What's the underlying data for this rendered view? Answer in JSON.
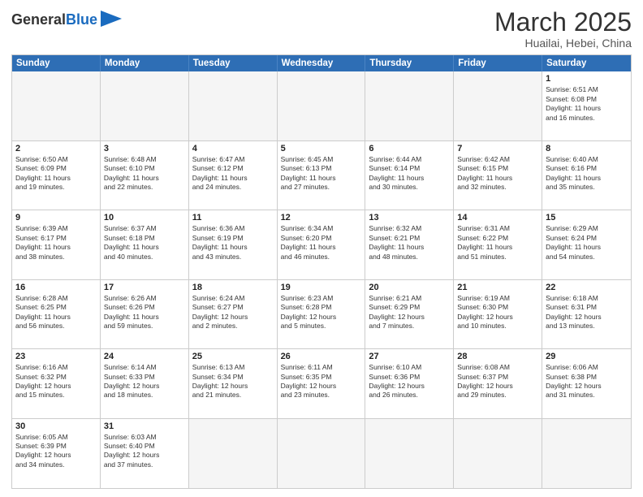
{
  "header": {
    "logo_general": "General",
    "logo_blue": "Blue",
    "month_year": "March 2025",
    "location": "Huailai, Hebei, China"
  },
  "weekdays": [
    "Sunday",
    "Monday",
    "Tuesday",
    "Wednesday",
    "Thursday",
    "Friday",
    "Saturday"
  ],
  "cells": [
    {
      "day": "",
      "info": "",
      "empty": true
    },
    {
      "day": "",
      "info": "",
      "empty": true
    },
    {
      "day": "",
      "info": "",
      "empty": true
    },
    {
      "day": "",
      "info": "",
      "empty": true
    },
    {
      "day": "",
      "info": "",
      "empty": true
    },
    {
      "day": "",
      "info": "",
      "empty": true
    },
    {
      "day": "1",
      "info": "Sunrise: 6:51 AM\nSunset: 6:08 PM\nDaylight: 11 hours\nand 16 minutes.",
      "empty": false
    },
    {
      "day": "2",
      "info": "Sunrise: 6:50 AM\nSunset: 6:09 PM\nDaylight: 11 hours\nand 19 minutes.",
      "empty": false
    },
    {
      "day": "3",
      "info": "Sunrise: 6:48 AM\nSunset: 6:10 PM\nDaylight: 11 hours\nand 22 minutes.",
      "empty": false
    },
    {
      "day": "4",
      "info": "Sunrise: 6:47 AM\nSunset: 6:12 PM\nDaylight: 11 hours\nand 24 minutes.",
      "empty": false
    },
    {
      "day": "5",
      "info": "Sunrise: 6:45 AM\nSunset: 6:13 PM\nDaylight: 11 hours\nand 27 minutes.",
      "empty": false
    },
    {
      "day": "6",
      "info": "Sunrise: 6:44 AM\nSunset: 6:14 PM\nDaylight: 11 hours\nand 30 minutes.",
      "empty": false
    },
    {
      "day": "7",
      "info": "Sunrise: 6:42 AM\nSunset: 6:15 PM\nDaylight: 11 hours\nand 32 minutes.",
      "empty": false
    },
    {
      "day": "8",
      "info": "Sunrise: 6:40 AM\nSunset: 6:16 PM\nDaylight: 11 hours\nand 35 minutes.",
      "empty": false
    },
    {
      "day": "9",
      "info": "Sunrise: 6:39 AM\nSunset: 6:17 PM\nDaylight: 11 hours\nand 38 minutes.",
      "empty": false
    },
    {
      "day": "10",
      "info": "Sunrise: 6:37 AM\nSunset: 6:18 PM\nDaylight: 11 hours\nand 40 minutes.",
      "empty": false
    },
    {
      "day": "11",
      "info": "Sunrise: 6:36 AM\nSunset: 6:19 PM\nDaylight: 11 hours\nand 43 minutes.",
      "empty": false
    },
    {
      "day": "12",
      "info": "Sunrise: 6:34 AM\nSunset: 6:20 PM\nDaylight: 11 hours\nand 46 minutes.",
      "empty": false
    },
    {
      "day": "13",
      "info": "Sunrise: 6:32 AM\nSunset: 6:21 PM\nDaylight: 11 hours\nand 48 minutes.",
      "empty": false
    },
    {
      "day": "14",
      "info": "Sunrise: 6:31 AM\nSunset: 6:22 PM\nDaylight: 11 hours\nand 51 minutes.",
      "empty": false
    },
    {
      "day": "15",
      "info": "Sunrise: 6:29 AM\nSunset: 6:24 PM\nDaylight: 11 hours\nand 54 minutes.",
      "empty": false
    },
    {
      "day": "16",
      "info": "Sunrise: 6:28 AM\nSunset: 6:25 PM\nDaylight: 11 hours\nand 56 minutes.",
      "empty": false
    },
    {
      "day": "17",
      "info": "Sunrise: 6:26 AM\nSunset: 6:26 PM\nDaylight: 11 hours\nand 59 minutes.",
      "empty": false
    },
    {
      "day": "18",
      "info": "Sunrise: 6:24 AM\nSunset: 6:27 PM\nDaylight: 12 hours\nand 2 minutes.",
      "empty": false
    },
    {
      "day": "19",
      "info": "Sunrise: 6:23 AM\nSunset: 6:28 PM\nDaylight: 12 hours\nand 5 minutes.",
      "empty": false
    },
    {
      "day": "20",
      "info": "Sunrise: 6:21 AM\nSunset: 6:29 PM\nDaylight: 12 hours\nand 7 minutes.",
      "empty": false
    },
    {
      "day": "21",
      "info": "Sunrise: 6:19 AM\nSunset: 6:30 PM\nDaylight: 12 hours\nand 10 minutes.",
      "empty": false
    },
    {
      "day": "22",
      "info": "Sunrise: 6:18 AM\nSunset: 6:31 PM\nDaylight: 12 hours\nand 13 minutes.",
      "empty": false
    },
    {
      "day": "23",
      "info": "Sunrise: 6:16 AM\nSunset: 6:32 PM\nDaylight: 12 hours\nand 15 minutes.",
      "empty": false
    },
    {
      "day": "24",
      "info": "Sunrise: 6:14 AM\nSunset: 6:33 PM\nDaylight: 12 hours\nand 18 minutes.",
      "empty": false
    },
    {
      "day": "25",
      "info": "Sunrise: 6:13 AM\nSunset: 6:34 PM\nDaylight: 12 hours\nand 21 minutes.",
      "empty": false
    },
    {
      "day": "26",
      "info": "Sunrise: 6:11 AM\nSunset: 6:35 PM\nDaylight: 12 hours\nand 23 minutes.",
      "empty": false
    },
    {
      "day": "27",
      "info": "Sunrise: 6:10 AM\nSunset: 6:36 PM\nDaylight: 12 hours\nand 26 minutes.",
      "empty": false
    },
    {
      "day": "28",
      "info": "Sunrise: 6:08 AM\nSunset: 6:37 PM\nDaylight: 12 hours\nand 29 minutes.",
      "empty": false
    },
    {
      "day": "29",
      "info": "Sunrise: 6:06 AM\nSunset: 6:38 PM\nDaylight: 12 hours\nand 31 minutes.",
      "empty": false
    },
    {
      "day": "30",
      "info": "Sunrise: 6:05 AM\nSunset: 6:39 PM\nDaylight: 12 hours\nand 34 minutes.",
      "empty": false
    },
    {
      "day": "31",
      "info": "Sunrise: 6:03 AM\nSunset: 6:40 PM\nDaylight: 12 hours\nand 37 minutes.",
      "empty": false
    },
    {
      "day": "",
      "info": "",
      "empty": true
    },
    {
      "day": "",
      "info": "",
      "empty": true
    },
    {
      "day": "",
      "info": "",
      "empty": true
    },
    {
      "day": "",
      "info": "",
      "empty": true
    },
    {
      "day": "",
      "info": "",
      "empty": true
    }
  ]
}
